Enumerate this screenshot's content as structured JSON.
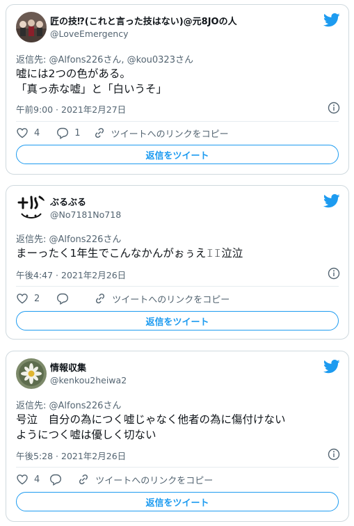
{
  "colors": {
    "accent": "#1d9bf0",
    "text": "#0f1419",
    "muted": "#536471",
    "border": "#cfd9de"
  },
  "tweets": [
    {
      "name": "匠の技⁉(これと言った技はない)@元8JOの人",
      "handle": "@LoveEmergency",
      "reply_to": "返信先: @Alfons226さん, @kou0323さん",
      "lines": [
        "嘘には2つの色がある。",
        "「真っ赤な嘘」と「白いうそ」"
      ],
      "timestamp": "午前9:00 · 2021年2月27日",
      "like_count": "4",
      "reply_count": "1",
      "copy_link_label": "ツイートへのリンクをコピー",
      "reply_button": "返信をツイート",
      "avatar_icon": "group-photo-avatar",
      "bird_icon": "twitter-bird-icon"
    },
    {
      "name": "ぶるぶる",
      "handle": "@No7181No718",
      "reply_to": "返信先: @Alfons226さん",
      "lines": [
        "まーったく1年生でこんなかんがぉぅえ𝙸𝙸泣泣"
      ],
      "timestamp": "午後4:47 · 2021年2月26日",
      "like_count": "2",
      "reply_count": "",
      "copy_link_label": "ツイートへのリンクをコピー",
      "reply_button": "返信をツイート",
      "avatar_icon": "doodle-avatar",
      "bird_icon": "twitter-bird-icon"
    },
    {
      "name": "情報収集",
      "handle": "@kenkou2heiwa2",
      "reply_to": "返信先: @Alfons226さん",
      "lines": [
        "号泣　自分の為につく嘘じゃなく他者の為に傷付けない",
        "ようにつく嘘は優しく切ない"
      ],
      "timestamp": "午後5:28 · 2021年2月26日",
      "like_count": "4",
      "reply_count": "",
      "copy_link_label": "ツイートへのリンクをコピー",
      "reply_button": "返信をツイート",
      "avatar_icon": "flower-avatar",
      "bird_icon": "twitter-bird-icon"
    }
  ]
}
